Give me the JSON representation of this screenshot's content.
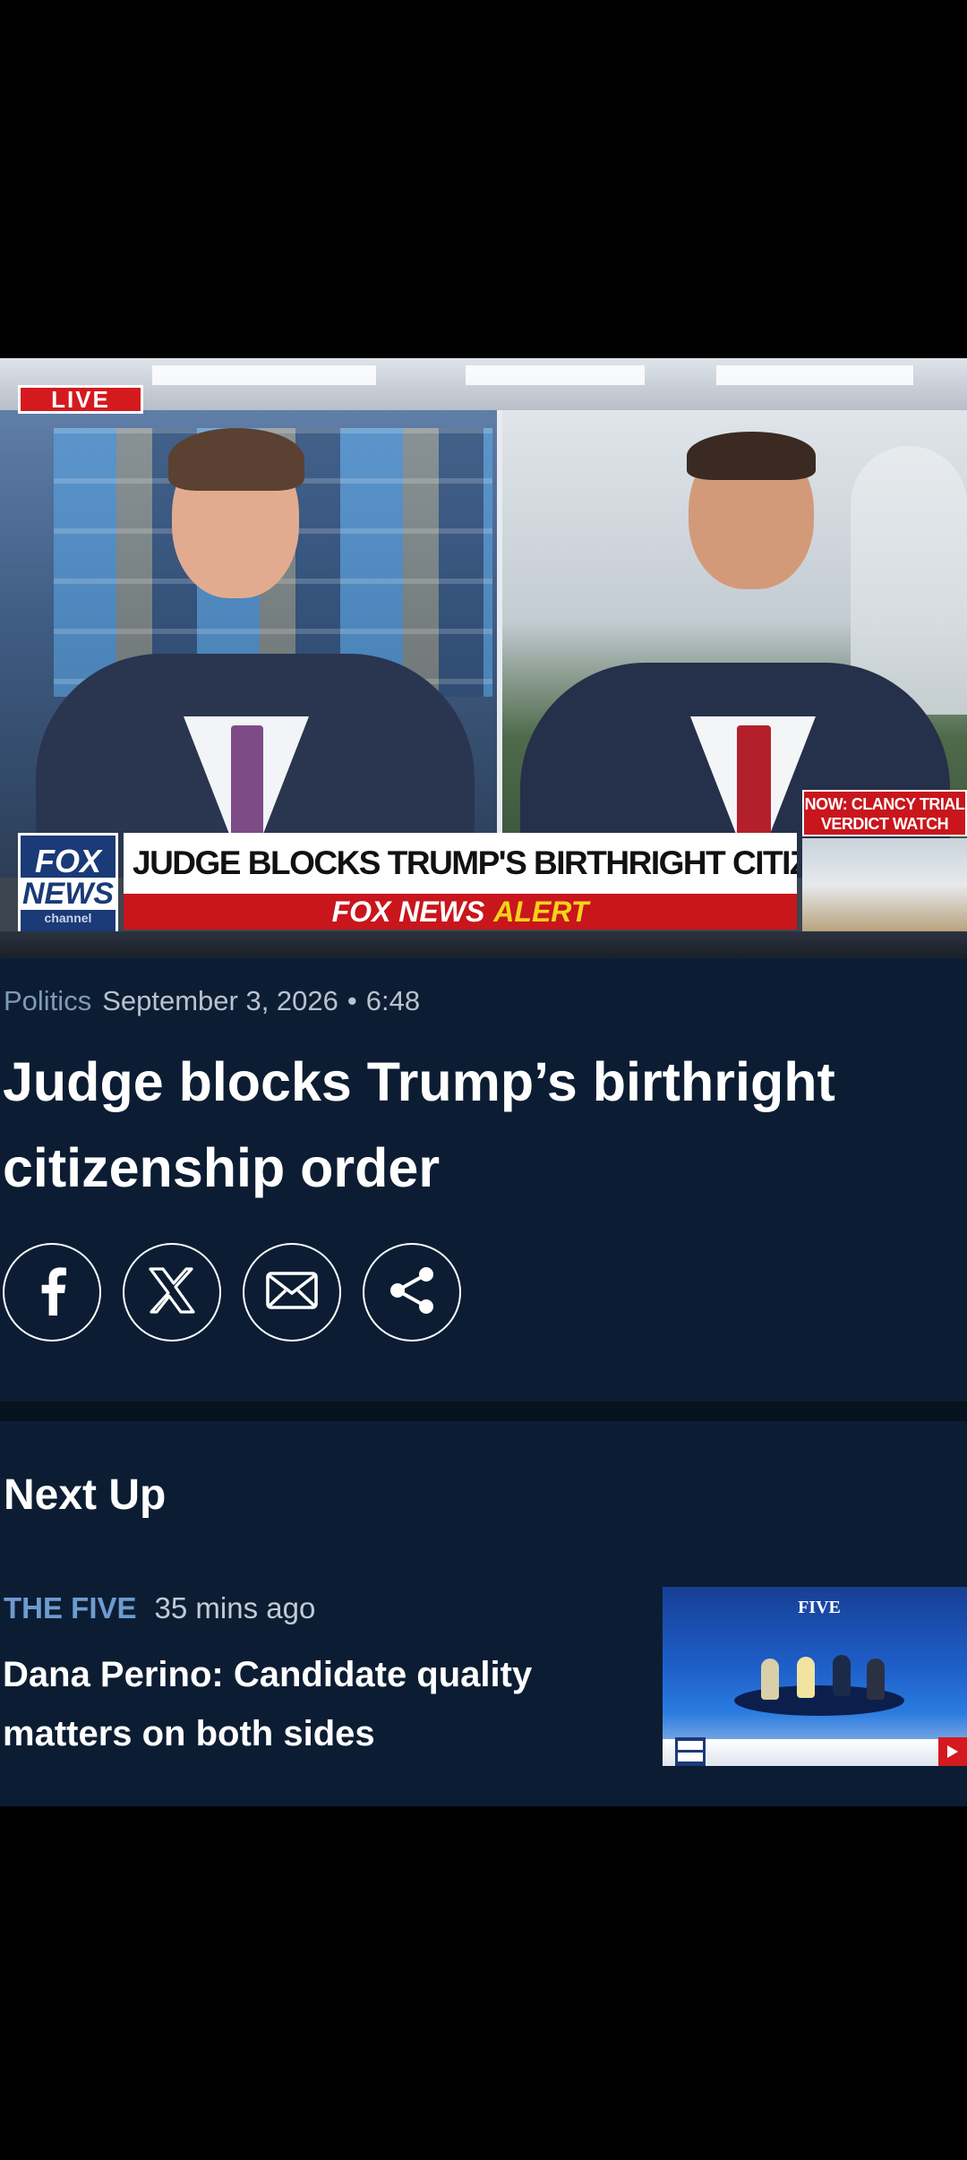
{
  "video": {
    "live_label": "LIVE",
    "logo_line1": "FOX",
    "logo_line2": "NEWS",
    "logo_line3": "channel",
    "headline": "JUDGE BLOCKS TRUMP'S BIRTHRIGHT CITIZENSHIP E.O.",
    "alert_brand": "FOX NEWS",
    "alert_label": "ALERT",
    "side_box": "NOW: CLANCY TRIAL VERDICT WATCH"
  },
  "article": {
    "category": "Politics",
    "date": "September 3, 2026",
    "separator": "•",
    "duration": "6:48",
    "title": "Judge blocks Trump’s birthright citizenship order",
    "share_icons": [
      "facebook-icon",
      "x-icon",
      "email-icon",
      "share-icon"
    ]
  },
  "next_up": {
    "heading": "Next Up",
    "show": "THE FIVE",
    "time_ago": "35 mins ago",
    "headline": "Dana Perino: Candidate quality matters on both sides",
    "thumb_sign": "FIVE"
  },
  "colors": {
    "background": "#0c1d33",
    "category": "#7f9ab8",
    "show_label": "#6e9bd0",
    "alert_red": "#c8161c",
    "alert_yellow": "#f6d31a"
  }
}
